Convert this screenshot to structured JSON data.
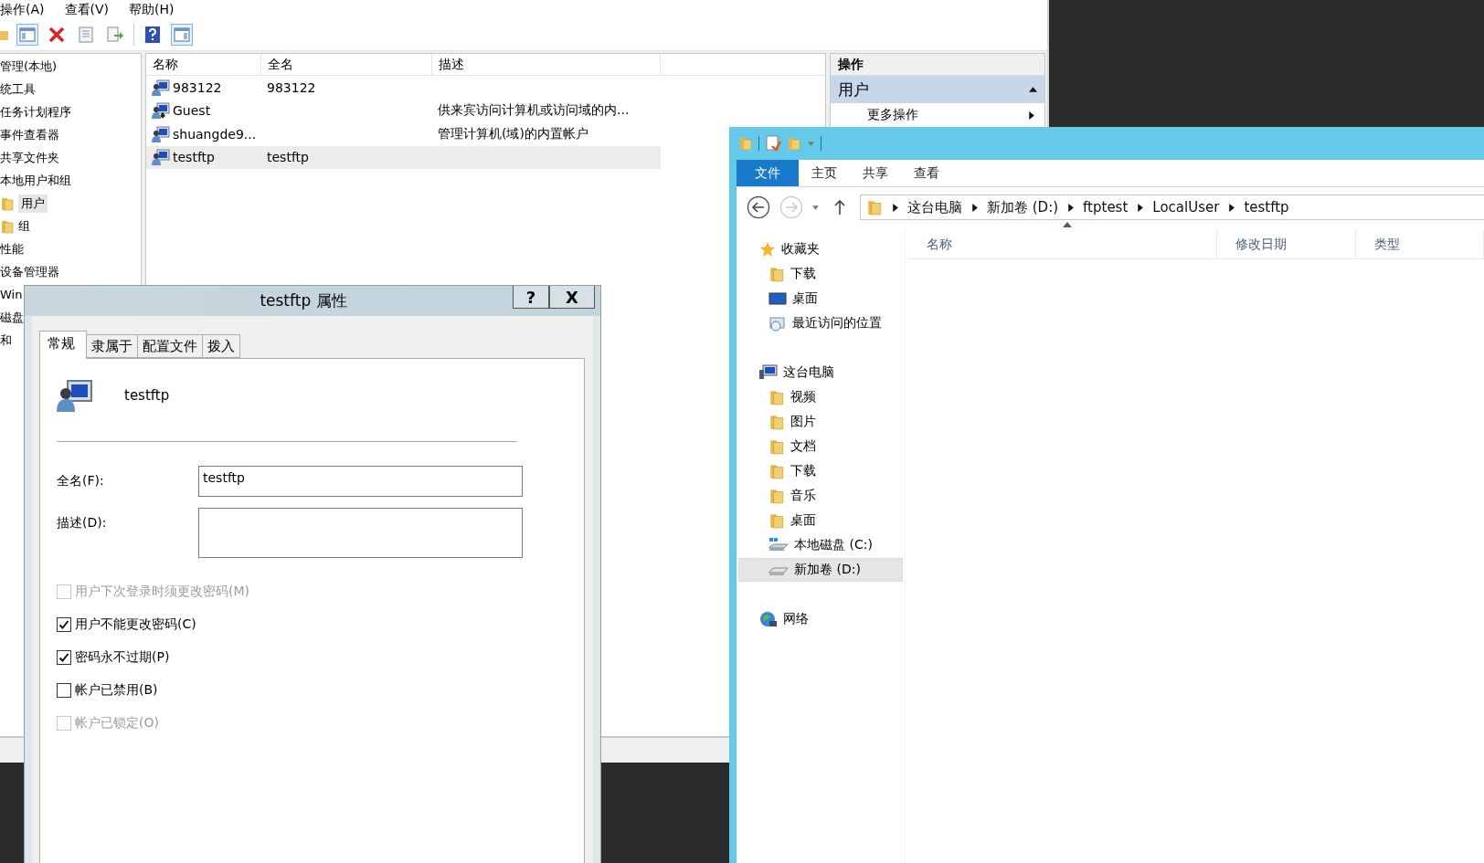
{
  "mmc": {
    "menu": [
      "操作(A)",
      "查看(V)",
      "帮助(H)"
    ],
    "tree": [
      {
        "label": "管理(本地)",
        "selected": false
      },
      {
        "label": "统工具",
        "selected": false
      },
      {
        "label": "任务计划程序",
        "selected": false
      },
      {
        "label": "事件查看器",
        "selected": false
      },
      {
        "label": "共享文件夹",
        "selected": false
      },
      {
        "label": "本地用户和组",
        "selected": false,
        "children": [
          {
            "label": "用户",
            "selected": true
          },
          {
            "label": "组",
            "selected": false
          }
        ]
      },
      {
        "label": "性能",
        "selected": false
      },
      {
        "label": "设备管理器",
        "selected": false
      },
      {
        "label": "Win",
        "selected": false
      },
      {
        "label": "磁盘",
        "selected": false
      },
      {
        "label": "和",
        "selected": false
      }
    ],
    "list": {
      "columns": [
        "名称",
        "全名",
        "描述"
      ],
      "rows": [
        {
          "name": "983122",
          "full_name": "983122",
          "disabled": false,
          "selected": false
        },
        {
          "name": "Guest",
          "description": "供来宾访问计算机或访问域的内...",
          "disabled": true,
          "selected": false
        },
        {
          "name": "shuangde9...",
          "description": "管理计算机(域)的内置帐户",
          "disabled": false,
          "selected": false
        },
        {
          "name": "testftp",
          "full_name": "testftp",
          "disabled": false,
          "selected": true
        }
      ]
    },
    "actions": {
      "title": "操作",
      "section": "用户",
      "items": [
        "更多操作"
      ]
    }
  },
  "dialog": {
    "title": "testftp 属性",
    "help": "?",
    "close": "X",
    "tabs": [
      {
        "label": "常规",
        "selected": true
      },
      {
        "label": "隶属于",
        "selected": false
      },
      {
        "label": "配置文件",
        "selected": false
      },
      {
        "label": "拨入",
        "selected": false
      }
    ],
    "user_name": "testftp",
    "fields": [
      {
        "label": "全名(F):",
        "value": "testftp",
        "kind": "line"
      },
      {
        "label": "描述(D):",
        "kind": "area"
      }
    ],
    "checkboxes": [
      {
        "label": "用户下次登录时须更改密码(M)",
        "checked": false,
        "disabled": true
      },
      {
        "label": "用户不能更改密码(C)",
        "checked": true,
        "disabled": false
      },
      {
        "label": "密码永不过期(P)",
        "checked": true,
        "disabled": false
      },
      {
        "label": "帐户已禁用(B)",
        "checked": false,
        "disabled": false
      },
      {
        "label": "帐户已锁定(O)",
        "checked": false,
        "disabled": true
      }
    ]
  },
  "explorer": {
    "ribbon_tabs": [
      {
        "label": "文件",
        "selected": true
      },
      {
        "label": "主页",
        "selected": false
      },
      {
        "label": "共享",
        "selected": false
      },
      {
        "label": "查看",
        "selected": false
      }
    ],
    "breadcrumbs": [
      "这台电脑",
      "新加卷 (D:)",
      "ftptest",
      "LocalUser",
      "testftp"
    ],
    "nav": [
      {
        "label": "收藏夹",
        "selected": false,
        "children": [
          {
            "label": "下载",
            "selected": false
          },
          {
            "label": "桌面",
            "selected": false
          },
          {
            "label": "最近访问的位置",
            "selected": false
          }
        ]
      },
      {
        "label": "这台电脑",
        "selected": false,
        "children": [
          {
            "label": "视频",
            "selected": false
          },
          {
            "label": "图片",
            "selected": false
          },
          {
            "label": "文档",
            "selected": false
          },
          {
            "label": "下载",
            "selected": false
          },
          {
            "label": "音乐",
            "selected": false
          },
          {
            "label": "桌面",
            "selected": false
          },
          {
            "label": "本地磁盘 (C:)",
            "selected": false
          },
          {
            "label": "新加卷 (D:)",
            "selected": true
          }
        ]
      },
      {
        "label": "网络",
        "selected": false
      }
    ],
    "columns": [
      "名称",
      "修改日期",
      "类型"
    ]
  }
}
